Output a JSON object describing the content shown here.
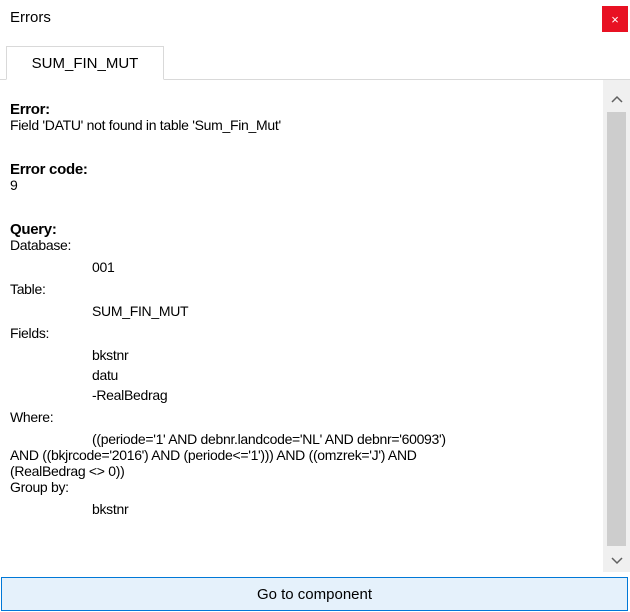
{
  "window": {
    "title": "Errors",
    "close_glyph": "×"
  },
  "tabs": [
    {
      "label": "SUM_FIN_MUT",
      "active": true
    }
  ],
  "error": {
    "label": "Error:",
    "message": "Field 'DATU' not found in table 'Sum_Fin_Mut'"
  },
  "error_code": {
    "label": "Error code:",
    "value": "9"
  },
  "query": {
    "label": "Query:",
    "database_label": "Database:",
    "database_value": "001",
    "table_label": "Table:",
    "table_value": "SUM_FIN_MUT",
    "fields_label": "Fields:",
    "fields": [
      "bkstnr",
      "datu",
      "-RealBedrag"
    ],
    "where_label": "Where:",
    "where_lines": [
      "((periode='1' AND debnr.landcode='NL' AND debnr='60093')",
      "AND ((bkjrcode='2016') AND (periode<='1'))) AND ((omzrek='J') AND",
      "(RealBedrag <> 0))"
    ],
    "groupby_label": "Group by:",
    "groupby_value": "bkstnr"
  },
  "scrollbar": {
    "up_icon": "chevron-up-icon",
    "down_icon": "chevron-down-icon"
  },
  "footer": {
    "button_label": "Go to component"
  },
  "colors": {
    "close_bg": "#e81123",
    "button_bg": "#e5f1fb",
    "button_border": "#0078d7"
  }
}
